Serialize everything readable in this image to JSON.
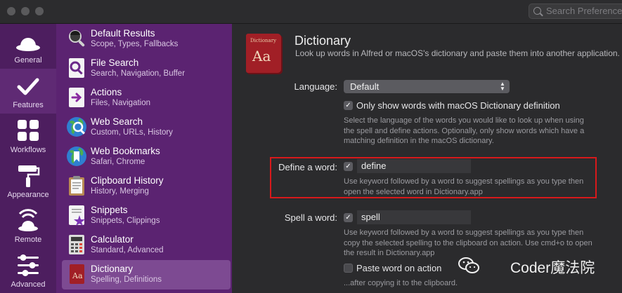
{
  "titlebar": {
    "search_placeholder": "Search Preferences"
  },
  "nav": {
    "items": [
      {
        "label": "General",
        "icon": "hat-icon"
      },
      {
        "label": "Features",
        "icon": "checkmark-icon"
      },
      {
        "label": "Workflows",
        "icon": "grid-icon"
      },
      {
        "label": "Appearance",
        "icon": "paint-roller-icon"
      },
      {
        "label": "Remote",
        "icon": "remote-broadcast-icon"
      },
      {
        "label": "Advanced",
        "icon": "sliders-icon"
      }
    ],
    "active": "Features"
  },
  "features": [
    {
      "title": "Default Results",
      "subtitle": "Scope, Types, Fallbacks",
      "icon": "magnifier-hat-icon"
    },
    {
      "title": "File Search",
      "subtitle": "Search, Navigation, Buffer",
      "icon": "file-search-icon"
    },
    {
      "title": "Actions",
      "subtitle": "Files, Navigation",
      "icon": "actions-icon"
    },
    {
      "title": "Web Search",
      "subtitle": "Custom, URLs, History",
      "icon": "globe-search-icon"
    },
    {
      "title": "Web Bookmarks",
      "subtitle": "Safari, Chrome",
      "icon": "globe-bookmark-icon"
    },
    {
      "title": "Clipboard History",
      "subtitle": "History, Merging",
      "icon": "clipboard-icon"
    },
    {
      "title": "Snippets",
      "subtitle": "Snippets, Clippings",
      "icon": "snippets-icon"
    },
    {
      "title": "Calculator",
      "subtitle": "Standard, Advanced",
      "icon": "calculator-icon"
    },
    {
      "title": "Dictionary",
      "subtitle": "Spelling, Definitions",
      "icon": "dictionary-icon"
    }
  ],
  "selected_feature": "Dictionary",
  "main": {
    "icon_text_small": "Dictionary",
    "icon_text_big": "Aa",
    "title": "Dictionary",
    "subtitle": "Look up words in Alfred or macOS's dictionary and paste them into another application.",
    "language_label": "Language:",
    "language_value": "Default",
    "only_macos_label": "Only show words with macOS Dictionary definition",
    "only_macos_checked": true,
    "language_help": "Select the language of the words you would like to look up when using the spell and define actions. Optionally, only show words which have a matching definition in the macOS dictionary.",
    "define_label": "Define a word:",
    "define_checked": true,
    "define_keyword": "define",
    "define_help": "Use keyword followed by a word to suggest spellings as you type then open the selected word in Dictionary.app",
    "spell_label": "Spell a word:",
    "spell_checked": true,
    "spell_keyword": "spell",
    "spell_help": "Use keyword followed by a word to suggest spellings as you type then copy the selected spelling to the clipboard on action. Use cmd+o to open the result in Dictionary.app",
    "paste_label": "Paste word on action",
    "paste_checked": false,
    "paste_help": "...after copying it to the clipboard."
  },
  "watermark": {
    "text": "Coder魔法院",
    "icon": "wechat-icon"
  },
  "colors": {
    "nav_bg": "#4d1e5f",
    "list_bg": "#5b2371",
    "selected_bg": "#7d4a92",
    "highlight": "#d8191b"
  }
}
